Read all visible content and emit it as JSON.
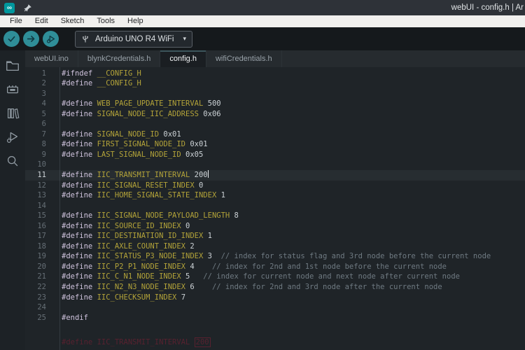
{
  "window": {
    "title": "webUI - config.h | Ar",
    "logo_glyph": "∞"
  },
  "menu": {
    "items": [
      "File",
      "Edit",
      "Sketch",
      "Tools",
      "Help"
    ]
  },
  "toolbar": {
    "board_selector": {
      "label": "Arduino UNO R4 WiFi",
      "caret": "▾"
    }
  },
  "tabs": [
    {
      "label": "webUI.ino",
      "active": false
    },
    {
      "label": "blynkCredentials.h",
      "active": false
    },
    {
      "label": "config.h",
      "active": true
    },
    {
      "label": "wifiCredentials.h",
      "active": false
    }
  ],
  "sidebar": {
    "icons": [
      "sketchbook-folder",
      "boards-manager",
      "library-manager",
      "debug",
      "search"
    ]
  },
  "editor": {
    "ghost_text": {
      "prefix": "#define IIC_TRANSMIT_INTERVAL ",
      "boxed": "200"
    },
    "lines": [
      {
        "num": 1,
        "tokens": [
          [
            "d",
            "#ifndef "
          ],
          [
            "m",
            "__CONFIG_H"
          ]
        ]
      },
      {
        "num": 2,
        "tokens": [
          [
            "d",
            "#define "
          ],
          [
            "m",
            "__CONFIG_H"
          ]
        ]
      },
      {
        "num": 3,
        "tokens": []
      },
      {
        "num": 4,
        "tokens": [
          [
            "d",
            "#define "
          ],
          [
            "m",
            "WEB_PAGE_UPDATE_INTERVAL"
          ],
          [
            "v",
            " 500"
          ]
        ]
      },
      {
        "num": 5,
        "tokens": [
          [
            "d",
            "#define "
          ],
          [
            "m",
            "SIGNAL_NODE_IIC_ADDRESS"
          ],
          [
            "v",
            " 0x06"
          ]
        ]
      },
      {
        "num": 6,
        "tokens": []
      },
      {
        "num": 7,
        "tokens": [
          [
            "d",
            "#define "
          ],
          [
            "m",
            "SIGNAL_NODE_ID"
          ],
          [
            "v",
            " 0x01"
          ]
        ]
      },
      {
        "num": 8,
        "tokens": [
          [
            "d",
            "#define "
          ],
          [
            "m",
            "FIRST_SIGNAL_NODE_ID"
          ],
          [
            "v",
            " 0x01"
          ]
        ]
      },
      {
        "num": 9,
        "tokens": [
          [
            "d",
            "#define "
          ],
          [
            "m",
            "LAST_SIGNAL_NODE_ID"
          ],
          [
            "v",
            " 0x05"
          ]
        ]
      },
      {
        "num": 10,
        "tokens": []
      },
      {
        "num": 11,
        "tokens": [
          [
            "d",
            "#define "
          ],
          [
            "m",
            "IIC_TRANSMIT_INTERVAL"
          ],
          [
            "v",
            " 200"
          ]
        ],
        "active": true,
        "cursor": true
      },
      {
        "num": 12,
        "tokens": [
          [
            "d",
            "#define "
          ],
          [
            "m",
            "IIC_SIGNAL_RESET_INDEX"
          ],
          [
            "v",
            " 0"
          ]
        ]
      },
      {
        "num": 13,
        "tokens": [
          [
            "d",
            "#define "
          ],
          [
            "m",
            "IIC_HOME_SIGNAL_STATE_INDEX"
          ],
          [
            "v",
            " 1"
          ]
        ]
      },
      {
        "num": 14,
        "tokens": []
      },
      {
        "num": 15,
        "tokens": [
          [
            "d",
            "#define "
          ],
          [
            "m",
            "IIC_SIGNAL_NODE_PAYLOAD_LENGTH"
          ],
          [
            "v",
            " 8"
          ]
        ]
      },
      {
        "num": 16,
        "tokens": [
          [
            "d",
            "#define "
          ],
          [
            "m",
            "IIC_SOURCE_ID_INDEX"
          ],
          [
            "v",
            " 0"
          ]
        ]
      },
      {
        "num": 17,
        "tokens": [
          [
            "d",
            "#define "
          ],
          [
            "m",
            "IIC_DESTINATION_ID_INDEX"
          ],
          [
            "v",
            " 1"
          ]
        ]
      },
      {
        "num": 18,
        "tokens": [
          [
            "d",
            "#define "
          ],
          [
            "m",
            "IIC_AXLE_COUNT_INDEX"
          ],
          [
            "v",
            " 2"
          ]
        ]
      },
      {
        "num": 19,
        "tokens": [
          [
            "d",
            "#define "
          ],
          [
            "m",
            "IIC_STATUS_P3_NODE_INDEX"
          ],
          [
            "v",
            " 3"
          ],
          [
            "c",
            "  // index for status flag and 3rd node before the current node"
          ]
        ]
      },
      {
        "num": 20,
        "tokens": [
          [
            "d",
            "#define "
          ],
          [
            "m",
            "IIC_P2_P1_NODE_INDEX"
          ],
          [
            "v",
            " 4"
          ],
          [
            "c",
            "    // index for 2nd and 1st node before the current node"
          ]
        ]
      },
      {
        "num": 21,
        "tokens": [
          [
            "d",
            "#define "
          ],
          [
            "m",
            "IIC_C_N1_NODE_INDEX"
          ],
          [
            "v",
            " 5"
          ],
          [
            "c",
            "   // index for current node and next node after current node"
          ]
        ]
      },
      {
        "num": 22,
        "tokens": [
          [
            "d",
            "#define "
          ],
          [
            "m",
            "IIC_N2_N3_NODE_INDEX"
          ],
          [
            "v",
            " 6"
          ],
          [
            "c",
            "    // index for 2nd and 3rd node after the current node"
          ]
        ]
      },
      {
        "num": 23,
        "tokens": [
          [
            "d",
            "#define "
          ],
          [
            "m",
            "IIC_CHECKSUM_INDEX"
          ],
          [
            "v",
            " 7"
          ]
        ]
      },
      {
        "num": 24,
        "tokens": []
      },
      {
        "num": 25,
        "tokens": [
          [
            "d",
            "#endif"
          ]
        ]
      }
    ]
  }
}
